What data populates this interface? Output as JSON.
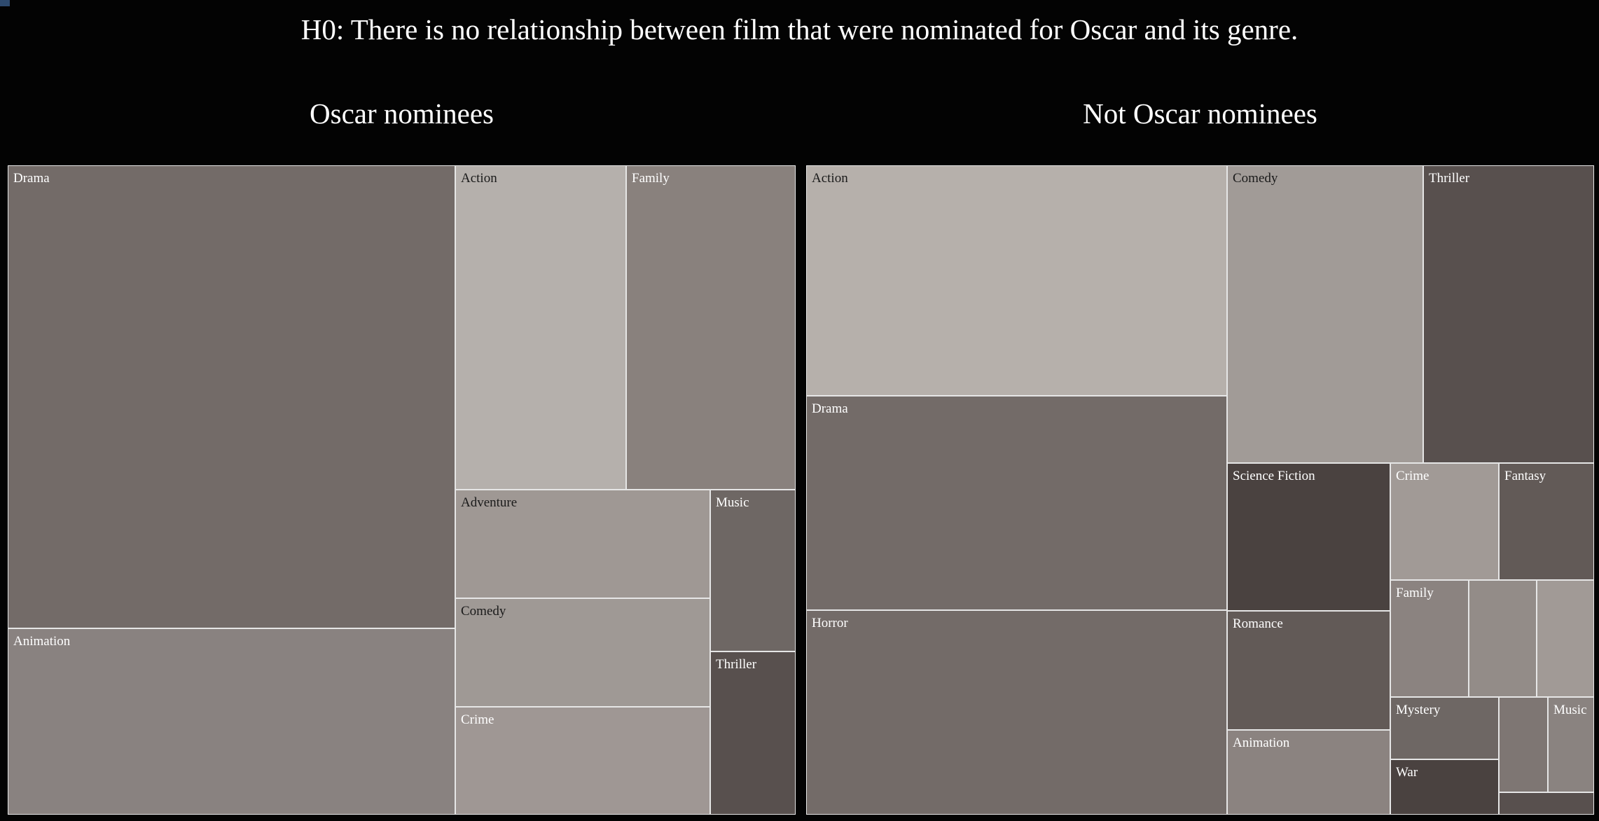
{
  "title": "H0: There is no relationship between film that were nominated for Oscar and its genre.",
  "chart_data": [
    {
      "type": "treemap",
      "title": "Oscar nominees",
      "labels": [
        "Drama",
        "Animation",
        "Action",
        "Family",
        "Adventure",
        "Comedy",
        "Crime",
        "Music",
        "Thriller"
      ],
      "colors": [
        "#736b68",
        "#898280",
        "#b5b0ac",
        "#89817d",
        "#9f9894",
        "#9f9995",
        "#9f9794",
        "#6e6764",
        "#58504e"
      ],
      "text_colors": [
        "#ffffff",
        "#ffffff",
        "#1a1a1a",
        "#ffffff",
        "#1a1a1a",
        "#1a1a1a",
        "#ffffff",
        "#ffffff",
        "#ffffff"
      ],
      "values": [
        38.8,
        16.1,
        13.8,
        13.7,
        6.6,
        6.6,
        6.6,
        3.3,
        3.3
      ]
    },
    {
      "type": "treemap",
      "title": "Not Oscar nominees",
      "labels": [
        "Action",
        "Drama",
        "Horror",
        "Comedy",
        "Thriller",
        "Science Fiction",
        "Romance",
        "Animation",
        "Crime",
        "Fantasy",
        "Family",
        "",
        "",
        "Mystery",
        "War",
        "",
        "Music",
        ""
      ],
      "colors": [
        "#b6b0ab",
        "#736b68",
        "#736b68",
        "#a19b97",
        "#58504e",
        "#4a4240",
        "#625a57",
        "#8b8380",
        "#a19a96",
        "#625a57",
        "#8b8380",
        "#938c88",
        "#a19a96",
        "#6e6764",
        "#4a4240",
        "#7e7673",
        "#8a8380",
        "#58504e"
      ],
      "text_colors": [
        "#1a1a1a",
        "#ffffff",
        "#ffffff",
        "#1a1a1a",
        "#ffffff",
        "#ffffff",
        "#ffffff",
        "#ffffff",
        "#ffffff",
        "#ffffff",
        "#ffffff",
        "#ffffff",
        "#ffffff",
        "#ffffff",
        "#ffffff",
        "#ffffff",
        "#ffffff",
        "#ffffff"
      ],
      "values": [
        18.5,
        17.3,
        16.5,
        12.3,
        10.6,
        5.8,
        4.7,
        3.4,
        3.1,
        2.7,
        2.5,
        1.9,
        1.6,
        1.6,
        1.4,
        1.2,
        0.9,
        0.6
      ]
    }
  ]
}
